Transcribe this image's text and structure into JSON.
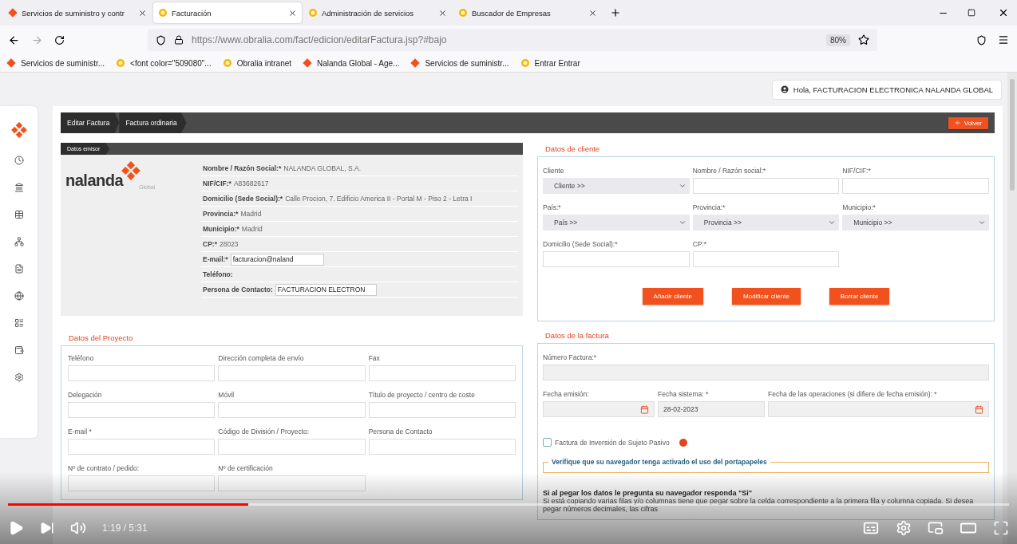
{
  "browser": {
    "tabs": [
      {
        "label": "Servicios de suministro y contr",
        "kind": "diamond",
        "selected": false
      },
      {
        "label": "Facturación",
        "kind": "circle",
        "selected": true
      },
      {
        "label": "Administración de servicios",
        "kind": "circle",
        "selected": false
      },
      {
        "label": "Buscador de Empresas",
        "kind": "circle",
        "selected": false
      }
    ],
    "address": "https://www.obralia.com/fact/edicion/editarFactura.jsp?#bajo",
    "zoom": "80%",
    "bookmarks": [
      {
        "label": "Servicios de suministr...",
        "kind": "diamond"
      },
      {
        "label": "<font color=\"509080\"...",
        "kind": "circle"
      },
      {
        "label": "Obralia intranet",
        "kind": "circle"
      },
      {
        "label": "Nalanda Global - Age...",
        "kind": "diamond"
      },
      {
        "label": "Servicios de suministr...",
        "kind": "diamond"
      },
      {
        "label": "Entrar  Entrar",
        "kind": "circle"
      }
    ]
  },
  "greeting": "Hola, FACTURACION ELECTRONICA NALANDA GLOBAL",
  "breadcrumb": [
    "Editar Factura",
    "Factura ordinaria"
  ],
  "back_button": "Volver",
  "issuer": {
    "title": "Datos emisor",
    "logo_text": "nalanda",
    "logo_sub": "Global",
    "rows": [
      {
        "label": "Nombre / Razón Social:*",
        "value": "NALANDA GLOBAL, S.A.",
        "kind": "text"
      },
      {
        "label": "NIF/CIF:*",
        "value": "A83682617",
        "kind": "text"
      },
      {
        "label": "Domicilio (Sede Social):*",
        "value": "Calle Procion, 7. Edificio America II - Portal M - Piso 2 - Letra I",
        "kind": "text"
      },
      {
        "label": "Provincia:*",
        "value": "Madrid",
        "kind": "text"
      },
      {
        "label": "Municipio:*",
        "value": "Madrid",
        "kind": "text"
      },
      {
        "label": "CP:*",
        "value": "28023",
        "kind": "text"
      },
      {
        "label": "E-mail:*",
        "value": "facturacion@naland",
        "kind": "input"
      },
      {
        "label": "Teléfono:",
        "kind": "text"
      },
      {
        "label": "Persona de Contacto:",
        "value": "FACTURACION ELECTRON",
        "kind": "input"
      }
    ]
  },
  "client": {
    "title": "Datos de cliente",
    "fields": [
      {
        "label": "Cliente",
        "kind": "select",
        "value": "Cliente >>"
      },
      {
        "label": "Nombre / Razón social:*",
        "kind": "input"
      },
      {
        "label": "NIF/CIF:*",
        "kind": "input"
      },
      {
        "label": "País:*",
        "kind": "select",
        "value": "País >>"
      },
      {
        "label": "Provincia:*",
        "kind": "select",
        "value": "Provincia >>"
      },
      {
        "label": "Municipio:*",
        "kind": "select",
        "value": "Municipio >>"
      },
      {
        "label": "Domicilio (Sede Social):*",
        "kind": "input"
      },
      {
        "label": "CP:*",
        "kind": "input"
      }
    ],
    "buttons": [
      "Añadir cliente",
      "Modificar cliente",
      "Borrar cliente"
    ]
  },
  "project": {
    "title": "Datos del Proyecto",
    "fields": [
      "Teléfono",
      "Dirección completa de envío",
      "Fax",
      "Delegación",
      "Móvil",
      "Título de proyecto / centro de coste",
      "E-mail *",
      "Código de División / Proyecto:",
      "Persona de Contacto",
      "Nº de contrato / pedido:",
      "Nº de certificación"
    ]
  },
  "invoice": {
    "title": "Datos de la factura",
    "number_label": "Número Factura:*",
    "dates": [
      {
        "label": "Fecha emisión:",
        "calendar": true
      },
      {
        "label": "Fecha sistema: *",
        "value": "28-02-2023",
        "calendar": false
      },
      {
        "label": "Fecha de las operaciones (si difiere de fecha emisión): *",
        "calendar": true
      }
    ],
    "checkbox": {
      "label": "Factura de Inversión de Sujeto Pasivo",
      "checked": false
    },
    "notice": "Verifique que su navegador tenga activado el uso del portapapeles",
    "paste_title": "Si al pegar los datos le pregunta su navegador responda \"Si\"",
    "paste_text": "Si está copiando varias filas y/o columnas tiene que pegar sobre la celda correspondiente a la primera fila y columna copiada. Si desea pegar números decimales, las cifras"
  },
  "video": {
    "progress": {
      "level": 0.24
    },
    "time": "1:19 / 5:31"
  }
}
